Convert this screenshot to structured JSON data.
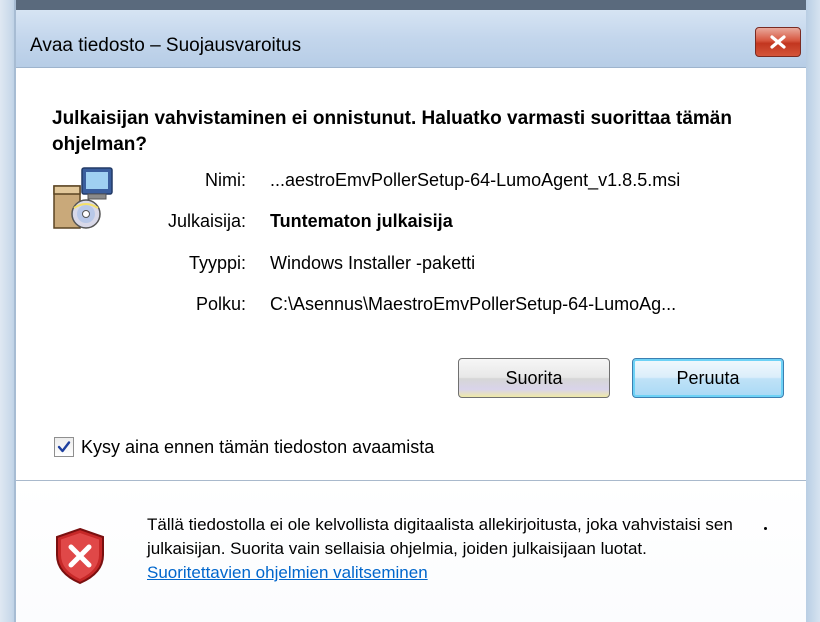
{
  "window": {
    "title": "Avaa tiedosto – Suojausvaroitus"
  },
  "headline": "Julkaisijan vahvistaminen ei onnistunut. Haluatko varmasti suorittaa tämän ohjelman?",
  "fields": {
    "name_label": "Nimi:",
    "name_value": "...aestroEmvPollerSetup-64-LumoAgent_v1.8.5.msi",
    "publisher_label": "Julkaisija:",
    "publisher_value": "Tuntematon julkaisija",
    "type_label": "Tyyppi:",
    "type_value": "Windows Installer -paketti",
    "path_label": "Polku:",
    "path_value": "C:\\Asennus\\MaestroEmvPollerSetup-64-LumoAg..."
  },
  "buttons": {
    "run_label": "Suorita",
    "cancel_label": "Peruuta"
  },
  "checkbox": {
    "label": "Kysy aina ennen tämän tiedoston avaamista",
    "checked": true
  },
  "footer": {
    "warning_text": "Tällä tiedostolla ei ole kelvollista digitaalista allekirjoitusta, joka vahvistaisi sen julkaisijan. Suorita vain sellaisia ohjelmia, joiden julkaisijaan luotat.",
    "link_text": "Suoritettavien ohjelmien valitseminen"
  },
  "icons": {
    "close": "close-icon",
    "package": "installer-package-icon",
    "checkmark": "checkmark-icon",
    "shield": "security-shield-error-icon"
  },
  "colors": {
    "link": "#0066cc",
    "close_button": "#c8402a",
    "cancel_button_border": "#3c7fb1",
    "shield_red": "#c62828"
  }
}
